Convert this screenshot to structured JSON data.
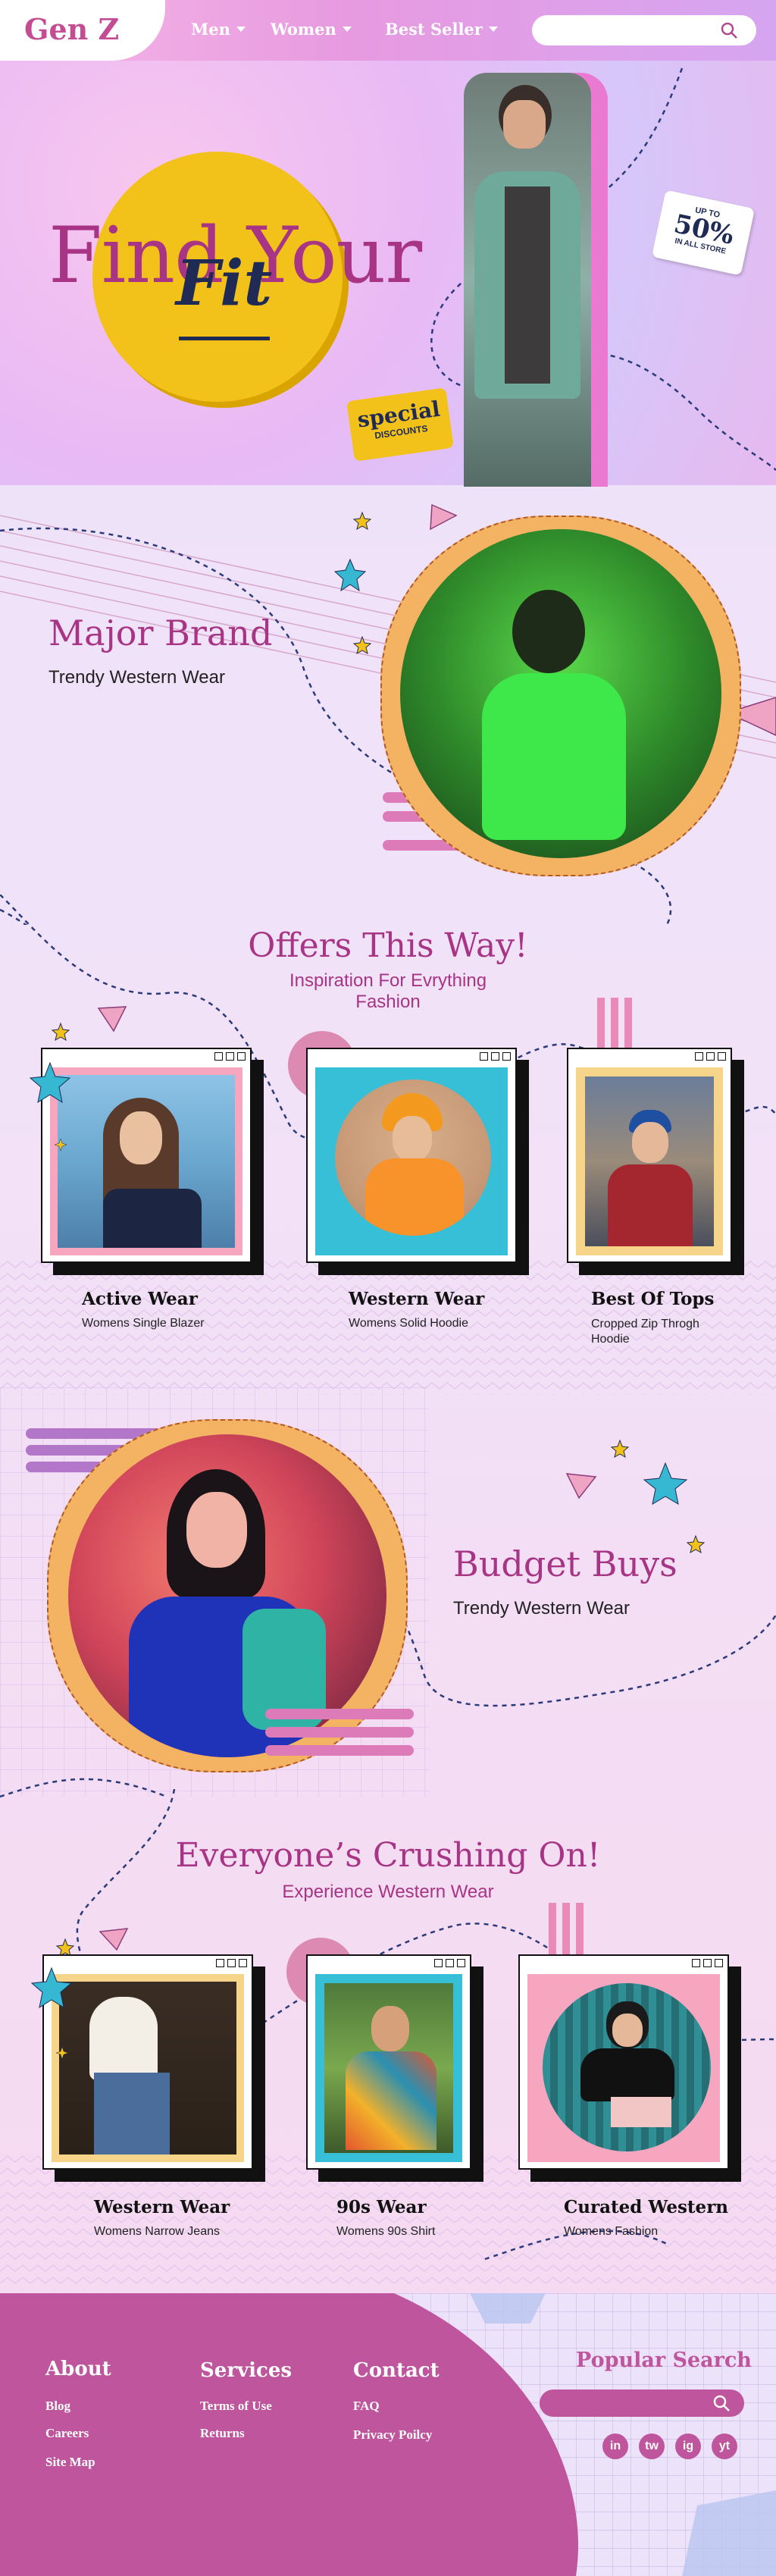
{
  "header": {
    "logo": "Gen Z",
    "nav": [
      {
        "label": "Men"
      },
      {
        "label": "Women"
      },
      {
        "label": "Best Seller"
      }
    ],
    "search_placeholder": ""
  },
  "hero": {
    "headline": "Find Your",
    "accent_word": "Fit",
    "tag_upto": "UP TO",
    "tag_percent": "50%",
    "tag_note": "IN ALL STORE",
    "special_label": "special",
    "special_sub": "DISCOUNTS"
  },
  "major_brand": {
    "title": "Major Brand",
    "subtitle": "Trendy Western Wear"
  },
  "offers": {
    "title": "Offers This Way!",
    "subtitle": "Inspiration For Evrything Fashion",
    "cards": [
      {
        "title": "Active Wear",
        "subtitle": "Womens Single Blazer"
      },
      {
        "title": "Western Wear",
        "subtitle": "Womens Solid Hoodie"
      },
      {
        "title": "Best Of Tops",
        "subtitle": "Cropped Zip Throgh Hoodie"
      }
    ]
  },
  "budget": {
    "title": "Budget Buys",
    "subtitle": "Trendy Western Wear"
  },
  "crushing": {
    "title": "Everyone’s Crushing On!",
    "subtitle": "Experience Western Wear",
    "cards": [
      {
        "title": "Western Wear",
        "subtitle": "Womens Narrow Jeans"
      },
      {
        "title": "90s Wear",
        "subtitle": "Womens 90s Shirt"
      },
      {
        "title": "Curated Western",
        "subtitle": "Womens Fashion"
      }
    ]
  },
  "footer": {
    "about": {
      "heading": "About",
      "links": [
        "Blog",
        "Careers",
        "Site Map"
      ]
    },
    "services": {
      "heading": "Services",
      "links": [
        "Terms of Use",
        "Returns"
      ]
    },
    "contact": {
      "heading": "Contact",
      "links": [
        "FAQ",
        "Privacy Poilcy"
      ]
    },
    "popular_search": "Popular Search",
    "social": [
      "in",
      "tw",
      "ig",
      "yt"
    ]
  },
  "colors": {
    "brand": "#c34c93",
    "accent_yellow": "#f2c21b",
    "footer": "#bf559c",
    "navy": "#1f2a55"
  }
}
